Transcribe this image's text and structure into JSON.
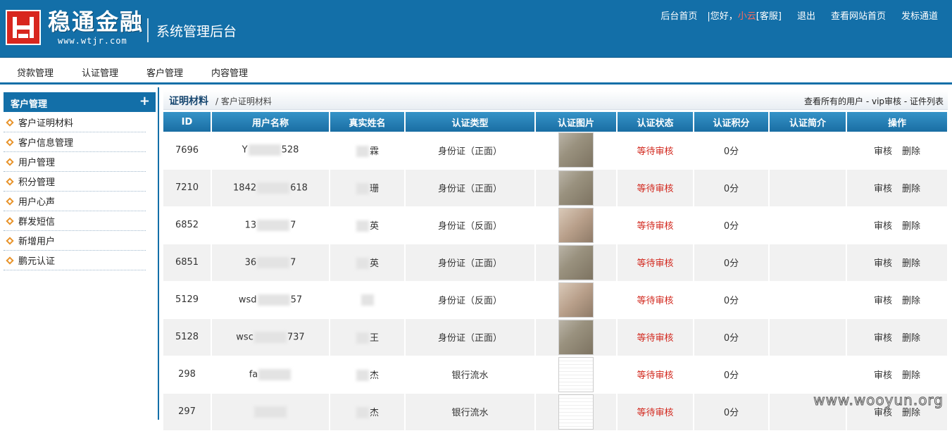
{
  "header": {
    "brand": "稳通金融",
    "brand_url": "www.wtjr.com",
    "system_title": "系统管理后台",
    "links": {
      "home": "后台首页",
      "greeting": "|您好，",
      "user": "小云",
      "role": "[客服]",
      "logout": "退出",
      "view_site": "查看网站首页",
      "post_channel": "发标通道"
    }
  },
  "mainnav": [
    "贷款管理",
    "认证管理",
    "客户管理",
    "内容管理"
  ],
  "sidebar": {
    "title": "客户管理",
    "items": [
      {
        "label": "客户证明材料"
      },
      {
        "label": "客户信息管理"
      },
      {
        "label": "用户管理"
      },
      {
        "label": "积分管理"
      },
      {
        "label": "用户心声"
      },
      {
        "label": "群发短信"
      },
      {
        "label": "新增用户"
      },
      {
        "label": "鹏元认证"
      }
    ]
  },
  "crumb": {
    "title": "证明材料",
    "rest": "/ 客户证明材料",
    "right": "查看所有的用户 - vip审核 - 证件列表"
  },
  "table": {
    "headers": [
      "ID",
      "用户名称",
      "真实姓名",
      "认证类型",
      "认证图片",
      "认证状态",
      "认证积分",
      "认证简介",
      "操作"
    ],
    "rows": [
      {
        "id": "7696",
        "username_a": "Y",
        "username_b": "528",
        "realname": "霖",
        "type": "身份证（正面）",
        "img": "front",
        "status": "等待审核",
        "points": "0分",
        "intro": "",
        "audit": "审核",
        "delete": "删除"
      },
      {
        "id": "7210",
        "username_a": "1842",
        "username_b": "618",
        "realname": "珊",
        "type": "身份证（正面）",
        "img": "front",
        "status": "等待审核",
        "points": "0分",
        "intro": "",
        "audit": "审核",
        "delete": "删除"
      },
      {
        "id": "6852",
        "username_a": "13",
        "username_b": "7",
        "realname": "英",
        "type": "身份证（反面）",
        "img": "back",
        "status": "等待审核",
        "points": "0分",
        "intro": "",
        "audit": "审核",
        "delete": "删除"
      },
      {
        "id": "6851",
        "username_a": "36",
        "username_b": "7",
        "realname": "英",
        "type": "身份证（正面）",
        "img": "front",
        "status": "等待审核",
        "points": "0分",
        "intro": "",
        "audit": "审核",
        "delete": "删除"
      },
      {
        "id": "5129",
        "username_a": "wsd",
        "username_b": "57",
        "realname": "",
        "type": "身份证（反面）",
        "img": "back",
        "status": "等待审核",
        "points": "0分",
        "intro": "",
        "audit": "审核",
        "delete": "删除"
      },
      {
        "id": "5128",
        "username_a": "wsc",
        "username_b": "737",
        "realname": "王",
        "type": "身份证（正面）",
        "img": "front",
        "status": "等待审核",
        "points": "0分",
        "intro": "",
        "audit": "审核",
        "delete": "删除"
      },
      {
        "id": "298",
        "username_a": "fa",
        "username_b": "",
        "realname": "杰",
        "type": "银行流水",
        "img": "doc",
        "status": "等待审核",
        "points": "0分",
        "intro": "",
        "audit": "审核",
        "delete": "删除"
      },
      {
        "id": "297",
        "username_a": "",
        "username_b": "",
        "realname": "杰",
        "type": "银行流水",
        "img": "doc",
        "status": "等待审核",
        "points": "0分",
        "intro": "",
        "audit": "审核",
        "delete": "删除"
      }
    ]
  },
  "watermark": "www.wooyun.org",
  "colors": {
    "brand_blue": "#136fa8",
    "logo_red": "#d8261e",
    "status_red": "#d2281e"
  }
}
